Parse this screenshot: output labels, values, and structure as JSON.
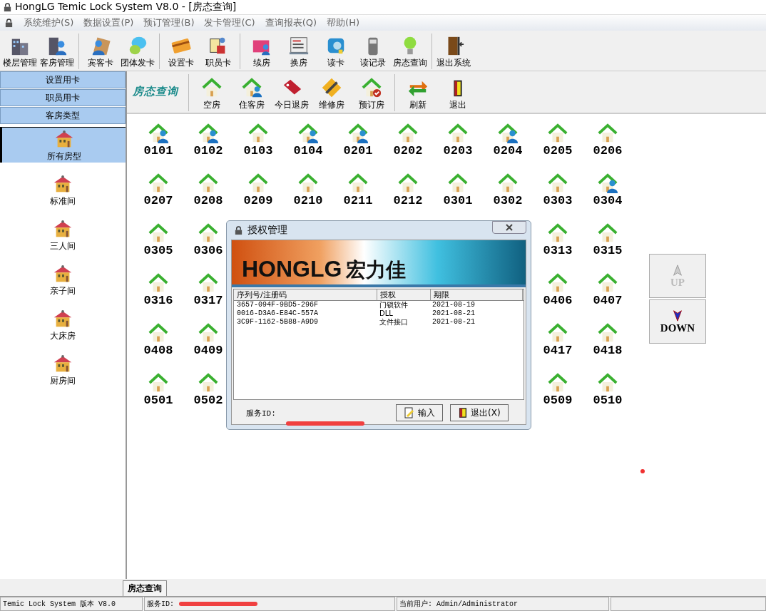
{
  "window": {
    "title": "HongLG Temic Lock System V8.0 - [房态查询]"
  },
  "menu": [
    "系统维护(S)",
    "数据设置(P)",
    "预订管理(B)",
    "发卡管理(C)",
    "查询报表(Q)",
    "帮助(H)"
  ],
  "toolbar": [
    [
      "楼层管理",
      "客房管理"
    ],
    [
      "宾客卡",
      "团体发卡"
    ],
    [
      "设置卡",
      "职员卡"
    ],
    [
      "续房",
      "换房",
      "读卡",
      "读记录",
      "房态查询"
    ],
    [
      "退出系统"
    ]
  ],
  "sidebar": {
    "sections": [
      "设置用卡",
      "职员用卡",
      "客房类型"
    ],
    "items": [
      {
        "label": "所有房型",
        "selected": true
      },
      {
        "label": "标准间",
        "selected": false
      },
      {
        "label": "三人间",
        "selected": false
      },
      {
        "label": "亲子间",
        "selected": false
      },
      {
        "label": "大床房",
        "selected": false
      },
      {
        "label": "厨房间",
        "selected": false
      }
    ]
  },
  "status_toolbar": {
    "title": "房态查询",
    "groups": [
      [
        "空房",
        "住客房",
        "今日退房",
        "维修房",
        "预订房"
      ],
      [
        "刷新",
        "退出"
      ]
    ]
  },
  "rooms": [
    {
      "start": [
        {
          "number": "0101",
          "occupied": true
        },
        {
          "number": "0102",
          "occupied": true
        },
        {
          "number": "0103",
          "occupied": false
        },
        {
          "number": "0104",
          "occupied": true
        },
        {
          "number": "0201",
          "occupied": true
        },
        {
          "number": "0202",
          "occupied": false
        },
        {
          "number": "0203",
          "occupied": false
        },
        {
          "number": "0204",
          "occupied": true
        },
        {
          "number": "0205",
          "occupied": false
        },
        {
          "number": "0206",
          "occupied": false
        }
      ]
    },
    {
      "start": [
        {
          "number": "0207",
          "occupied": false
        },
        {
          "number": "0208",
          "occupied": false
        },
        {
          "number": "0209",
          "occupied": false
        },
        {
          "number": "0210",
          "occupied": false
        },
        {
          "number": "0211",
          "occupied": false
        },
        {
          "number": "0212",
          "occupied": false
        },
        {
          "number": "0301",
          "occupied": false
        },
        {
          "number": "0302",
          "occupied": false
        },
        {
          "number": "0303",
          "occupied": false
        },
        {
          "number": "0304",
          "occupied": true
        }
      ]
    },
    {
      "start": [
        {
          "number": "0305",
          "occupied": false
        },
        {
          "number": "0306",
          "occupied": false
        }
      ],
      "end": [
        {
          "number": "0313",
          "occupied": false
        },
        {
          "number": "0315",
          "occupied": false
        }
      ]
    },
    {
      "start": [
        {
          "number": "0316",
          "occupied": false
        },
        {
          "number": "0317",
          "occupied": false
        }
      ],
      "end": [
        {
          "number": "0406",
          "occupied": false
        },
        {
          "number": "0407",
          "occupied": false
        }
      ]
    },
    {
      "start": [
        {
          "number": "0408",
          "occupied": false
        },
        {
          "number": "0409",
          "occupied": false
        }
      ],
      "end": [
        {
          "number": "0417",
          "occupied": false
        },
        {
          "number": "0418",
          "occupied": false
        }
      ]
    },
    {
      "start": [
        {
          "number": "0501",
          "occupied": false
        },
        {
          "number": "0502",
          "occupied": false
        }
      ],
      "end": [
        {
          "number": "0509",
          "occupied": false
        },
        {
          "number": "0510",
          "occupied": false
        }
      ]
    }
  ],
  "paging": [
    {
      "label": "UP",
      "disabled": true
    },
    {
      "label": "DOWN",
      "disabled": false
    }
  ],
  "dialog": {
    "title": "授权管理",
    "brand": "HONGLG",
    "brand_cn": "宏力佳",
    "columns": [
      "序列号/注册码",
      "授权",
      "期限"
    ],
    "rows": [
      [
        "3657-094F-9BD5-296F",
        "门锁软件",
        "2021-08-19"
      ],
      [
        "0016-D3A6-E84C-557A",
        "DLL",
        "2021-08-21"
      ],
      [
        "3C9F-1162-5B88-A9D9",
        "文件接口",
        "2021-08-21"
      ]
    ],
    "service_label": "服务ID:",
    "buttons": [
      "输入",
      "退出(X)"
    ]
  },
  "bottom_tab": "房态查询",
  "status_bar": [
    "Temic Lock System 版本 V8.0",
    "服务ID:",
    "当前用户: Admin/Administrator"
  ]
}
